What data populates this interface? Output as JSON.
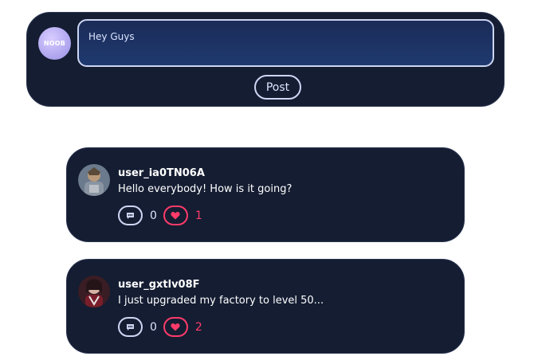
{
  "composer": {
    "avatar_label": "NOOB",
    "input_value": "Hey Guys",
    "post_label": "Post"
  },
  "posts": [
    {
      "username": "user_ia0TN06A",
      "message": "Hello everybody! How is it going?",
      "comments": "0",
      "likes": "1",
      "avatar_icon": "user-avatar-icon"
    },
    {
      "username": "user_gxtlv08F",
      "message": "I just upgraded my factory to level 50...",
      "comments": "0",
      "likes": "2",
      "avatar_icon": "user-avatar-icon"
    }
  ],
  "colors": {
    "card_bg": "#141d32",
    "input_bg": "#1f3a70",
    "border_light": "#cdd6f2",
    "like_accent": "#ff3b6a"
  }
}
